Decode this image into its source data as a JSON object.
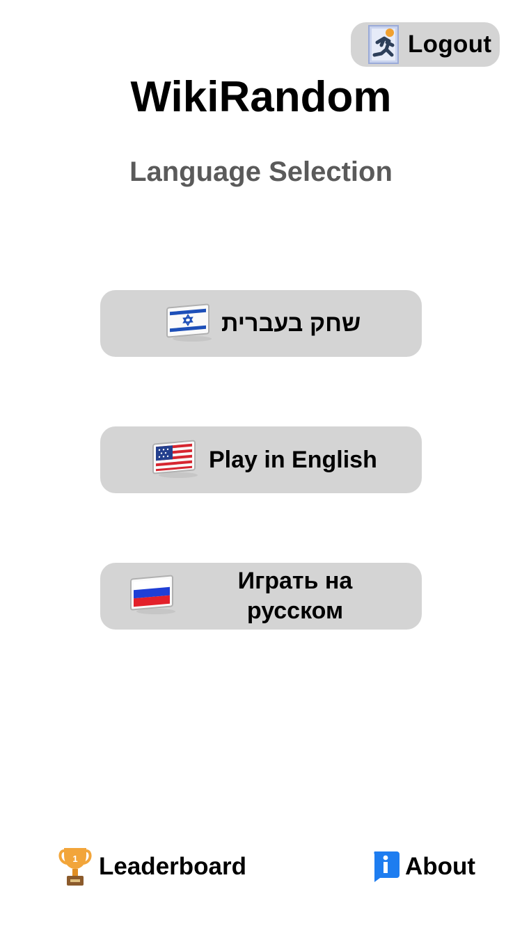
{
  "header": {
    "logout_label": "Logout",
    "title": "WikiRandom",
    "subtitle": "Language Selection"
  },
  "languages": [
    {
      "label": "שחק בעברית",
      "flag": "israel-flag-icon"
    },
    {
      "label": "Play in English",
      "flag": "usa-flag-icon"
    },
    {
      "label": "Играть на русском",
      "flag": "russia-flag-icon"
    }
  ],
  "footer": {
    "leaderboard_label": "Leaderboard",
    "leaderboard_icon": "trophy-icon",
    "about_label": "About",
    "about_icon": "info-icon"
  },
  "colors": {
    "button_bg": "#d4d4d4",
    "subtitle": "#5a5a5a",
    "about_icon_blue": "#1e7df0",
    "trophy_gold": "#f2a53a"
  }
}
